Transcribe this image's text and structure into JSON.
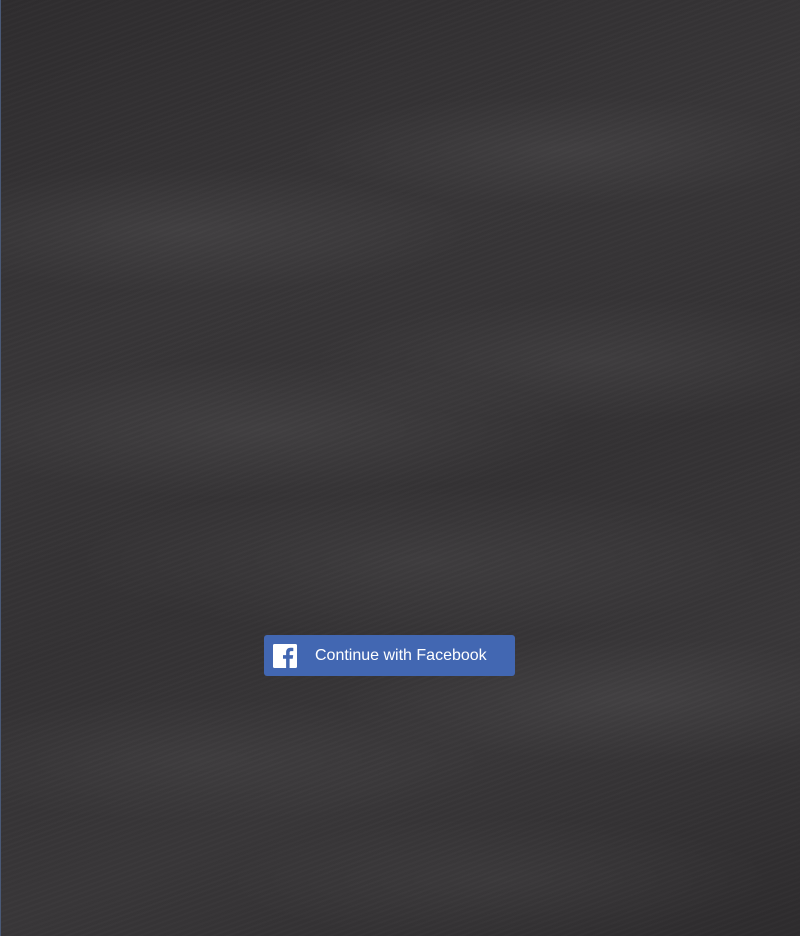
{
  "login": {
    "facebook_button_label": "Continue with Facebook",
    "facebook_icon": "facebook-f-icon",
    "button_color": "#4267b2",
    "background_color": "#353335"
  }
}
